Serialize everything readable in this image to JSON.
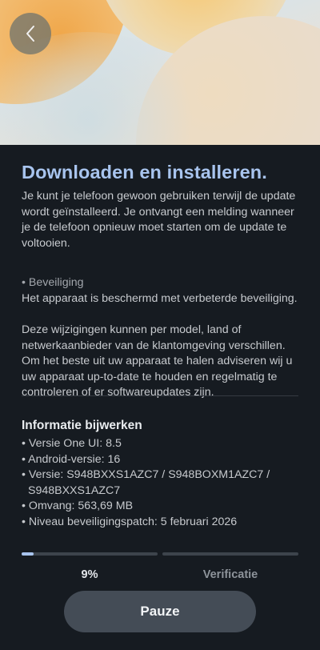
{
  "header": {
    "back_icon": "chevron-left-icon"
  },
  "main": {
    "title": "Downloaden en installeren.",
    "intro": "Je kunt je telefoon gewoon gebruiken terwijl de update wordt geïnstalleerd. Je ontvangt een melding wanneer je de telefoon opnieuw moet starten om de update te voltooien.",
    "security_bullet": "• Beveiliging",
    "security_text": "Het apparaat is beschermd met verbeterde beveiliging.",
    "disclaimer": "Deze wijzigingen kunnen per model, land of netwerkaanbieder van de klantomgeving verschillen. Om het beste uit uw apparaat te halen adviseren wij u uw apparaat up-to-date te houden en regelmatig te controleren of er softwareupdates zijn."
  },
  "info": {
    "title": "Informatie bijwerken",
    "items": [
      "• Versie One UI: 8.5",
      "• Android-versie: 16",
      "• Versie: S948BXXS1AZC7 / S948BOXM1AZC7 /",
      "S948BXXS1AZC7",
      "• Omvang: 563,69 MB",
      "• Niveau beveiligingspatch: 5 februari 2026"
    ]
  },
  "progress": {
    "percent_label": "9%",
    "fraction": 0.09,
    "stage_label": "Verificatie"
  },
  "actions": {
    "pause_label": "Pauze"
  },
  "colors": {
    "accent": "#a8c4ee",
    "background": "#161b21",
    "button": "#444c56"
  }
}
